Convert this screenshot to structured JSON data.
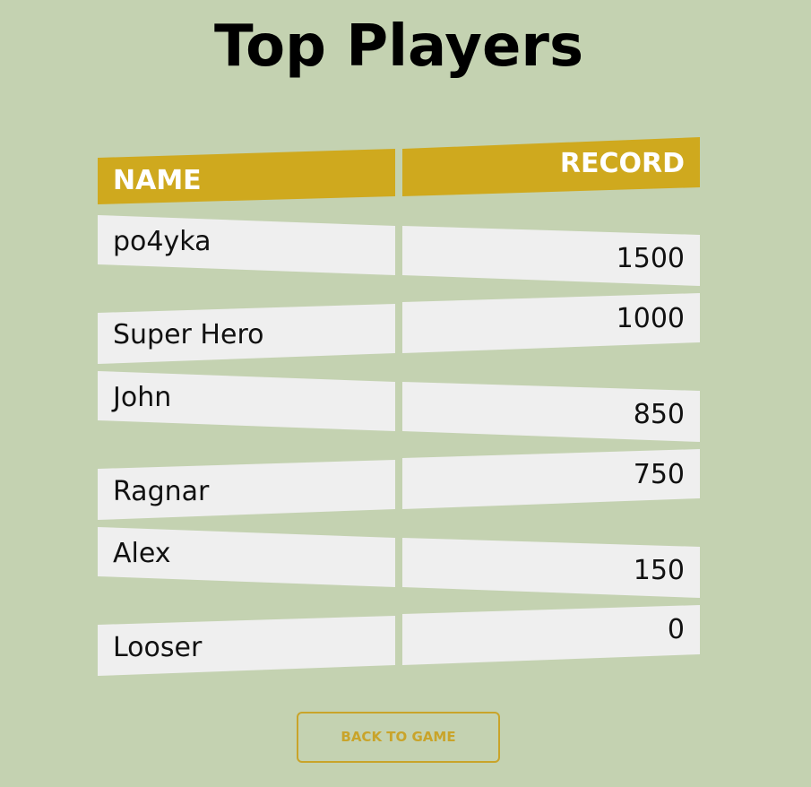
{
  "page_title": "Top Players",
  "table": {
    "headers": {
      "name": "NAME",
      "record": "RECORD"
    },
    "rows": [
      {
        "name": "po4yka",
        "record": "1500"
      },
      {
        "name": "Super Hero",
        "record": "1000"
      },
      {
        "name": "John",
        "record": "850"
      },
      {
        "name": "Ragnar",
        "record": "750"
      },
      {
        "name": "Alex",
        "record": "150"
      },
      {
        "name": "Looser",
        "record": "0"
      }
    ]
  },
  "actions": {
    "back_label": "BACK TO GAME"
  },
  "colors": {
    "background": "#c4d2b1",
    "header_accent": "#cfa91e",
    "cell_background": "#efefef",
    "button_accent": "#c9a42a"
  }
}
